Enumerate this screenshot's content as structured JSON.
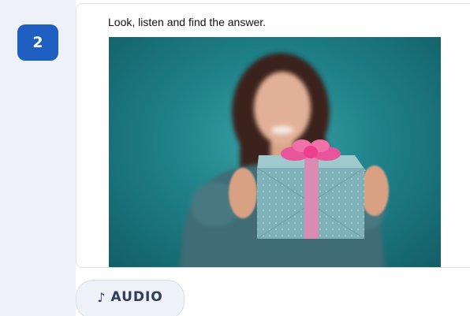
{
  "question": {
    "number": "2",
    "instruction": "Look, listen and find the answer."
  },
  "image": {
    "description_icon": "photo-woman-holding-gift"
  },
  "audio_button": {
    "icon": "♪",
    "label": "AUDIO"
  },
  "colors": {
    "badge": "#1e5fc1",
    "sidebar": "#eef2f8",
    "button_text": "#2e3d5c"
  }
}
